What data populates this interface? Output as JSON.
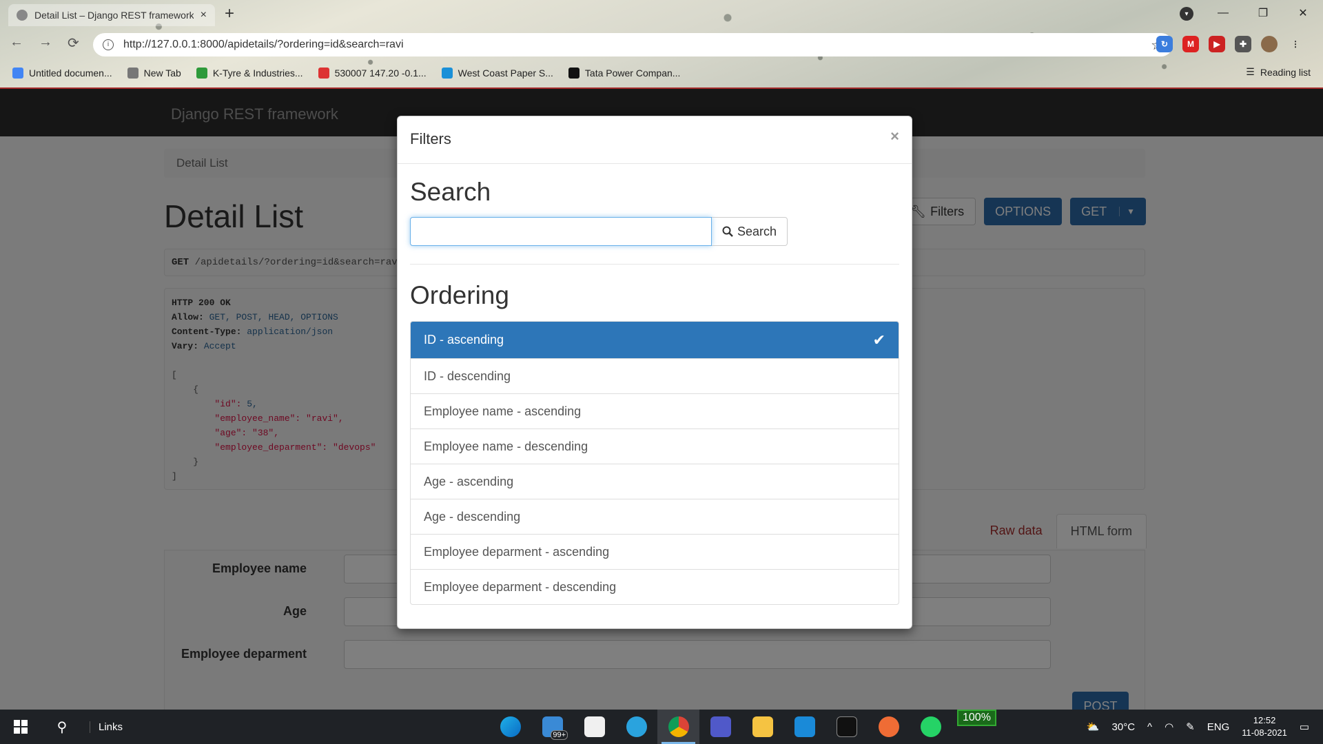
{
  "browser": {
    "tab_title": "Detail List – Django REST framework",
    "url": "http://127.0.0.1:8000/apidetails/?ordering=id&search=ravi",
    "bookmarks": [
      {
        "label": "Untitled documen...",
        "color": "#4285f4"
      },
      {
        "label": "New Tab",
        "color": "#777777"
      },
      {
        "label": "K-Tyre & Industries...",
        "color": "#2e9a3a"
      },
      {
        "label": "530007 147.20 -0.1...",
        "color": "#d33"
      },
      {
        "label": "West Coast Paper S...",
        "color": "#1a90d8"
      },
      {
        "label": "Tata Power Compan...",
        "color": "#111111"
      }
    ],
    "reading_list": "Reading list",
    "nav_back": "←",
    "nav_forward": "→",
    "nav_reload": "⟳",
    "star": "☆",
    "new_tab": "+",
    "win_minimize": "—",
    "win_restore": "❐",
    "win_close": "✕",
    "tab_close": "×"
  },
  "app": {
    "brand": "Django REST framework",
    "breadcrumb": "Detail List",
    "page_title": "Detail List",
    "buttons": {
      "filters": "Filters",
      "options": "OPTIONS",
      "get": "GET"
    },
    "request_method": "GET",
    "request_path": "/apidetails/?ordering=id&search=ravi",
    "response": {
      "status": "HTTP 200 OK",
      "allow_key": "Allow:",
      "allow": "GET, POST, HEAD, OPTIONS",
      "content_type_key": "Content-Type:",
      "content_type": "application/json",
      "vary_key": "Vary:",
      "vary": "Accept",
      "open_bracket": "[",
      "open_brace": "    {",
      "id_key": "        \"id\": ",
      "id_val": "5,",
      "name_key": "        \"employee_name\": ",
      "name_val": "\"ravi\",",
      "age_key": "        \"age\": ",
      "age_val": "\"38\",",
      "dept_key": "        \"employee_deparment\": ",
      "dept_val": "\"devops\"",
      "close_brace": "    }",
      "close_bracket": "]"
    },
    "form_tabs": {
      "raw": "Raw data",
      "html": "HTML form"
    },
    "form_fields": [
      "Employee name",
      "Age",
      "Employee deparment"
    ],
    "post_button": "POST"
  },
  "modal": {
    "title": "Filters",
    "close": "×",
    "search_heading": "Search",
    "search_value": "",
    "search_button": "Search",
    "ordering_heading": "Ordering",
    "ordering_options": [
      "ID - ascending",
      "ID - descending",
      "Employee name - ascending",
      "Employee name - descending",
      "Age - ascending",
      "Age - descending",
      "Employee deparment - ascending",
      "Employee deparment - descending"
    ],
    "selected_option": "ID - ascending"
  },
  "taskbar": {
    "links": "Links",
    "mail_badge": "99+",
    "battery": "100%",
    "temperature": "30°C",
    "language": "ENG",
    "time": "12:52",
    "date": "11-08-2021"
  }
}
